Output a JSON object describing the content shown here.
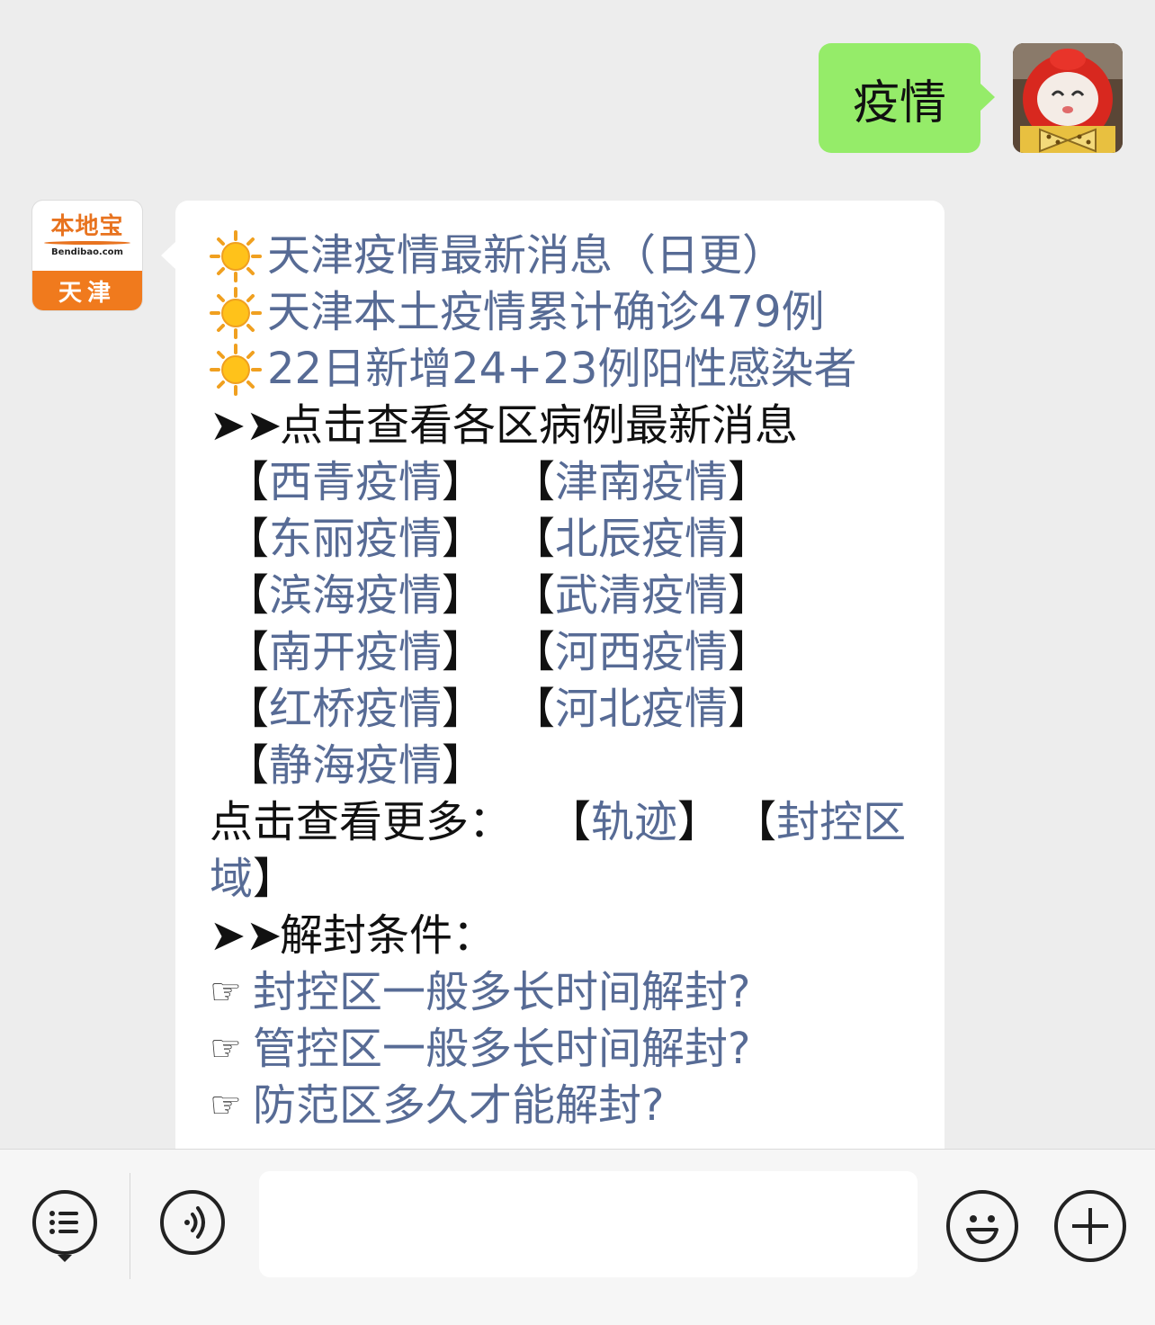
{
  "outgoing": {
    "text": "疫情"
  },
  "bot": {
    "avatar_brand": "本地宝",
    "avatar_domain": "Bendibao.com",
    "avatar_city": "天津"
  },
  "message": {
    "headline_links": [
      "天津疫情最新消息（日更）",
      "天津本土疫情累计确诊479例",
      "22日新增24+23例阳性感染者"
    ],
    "districts_heading": "点击查看各区病例最新消息",
    "district_pairs": [
      [
        "西青疫情",
        "津南疫情"
      ],
      [
        "东丽疫情",
        "北辰疫情"
      ],
      [
        "滨海疫情",
        "武清疫情"
      ],
      [
        "南开疫情",
        "河西疫情"
      ],
      [
        "红桥疫情",
        "河北疫情"
      ]
    ],
    "district_last": "静海疫情",
    "more_label": "点击查看更多：",
    "more_link1": "轨迹",
    "more_link2_part1": "封控区",
    "more_link2_part2": "域",
    "unseal_heading": "解封条件：",
    "unseal_links": [
      "封控区一般多长时间解封?",
      "管控区一般多长时间解封?",
      "防范区多久才能解封?"
    ]
  },
  "glyphs": {
    "arrow": "➤",
    "hand": "☞",
    "bracket_open": "【",
    "bracket_close": "】"
  },
  "colors": {
    "link": "#576b95",
    "outgoing_bubble": "#95ec69",
    "brand_orange": "#f07a1d"
  }
}
